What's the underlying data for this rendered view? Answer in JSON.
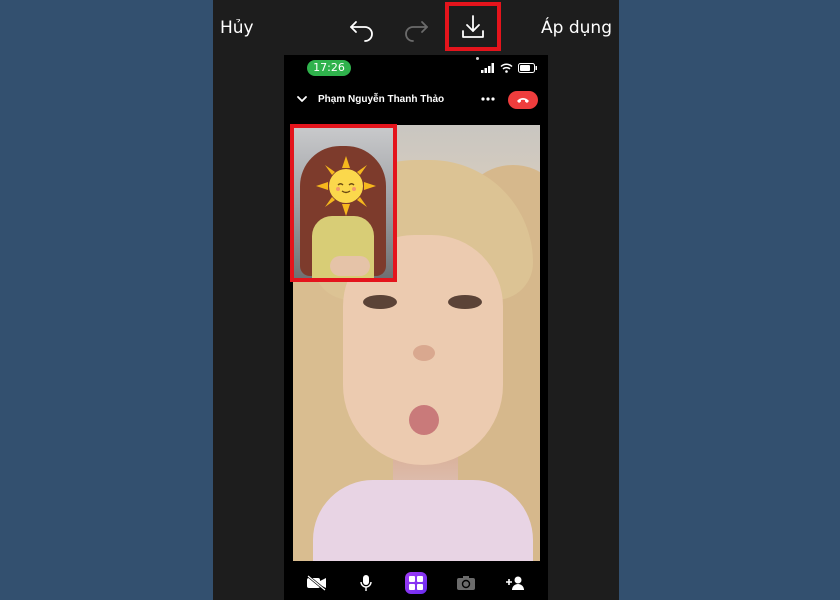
{
  "toolbar": {
    "cancel_label": "Hủy",
    "apply_label": "Áp dụng",
    "icons": [
      "undo-icon",
      "redo-icon",
      "download-icon"
    ]
  },
  "phone": {
    "status_time": "17:26",
    "status_icons": [
      "signal-icon",
      "wifi-icon",
      "battery-icon"
    ],
    "caller_name": "Phạm Nguyễn Thanh Thảo",
    "call_icons": [
      "chevron-down-icon",
      "more-icon",
      "end-call-icon"
    ],
    "bottom_icons": [
      "video-off-icon",
      "microphone-icon",
      "effects-icon",
      "switch-camera-icon",
      "add-person-icon"
    ]
  },
  "colors": {
    "page_background": "#33506f",
    "editor_background": "#1d1d1d",
    "highlight_red": "#e4141c",
    "time_pill_green": "#2fb24c",
    "end_call_red": "#ef3d3d",
    "effects_purple": "#8a34f2"
  }
}
